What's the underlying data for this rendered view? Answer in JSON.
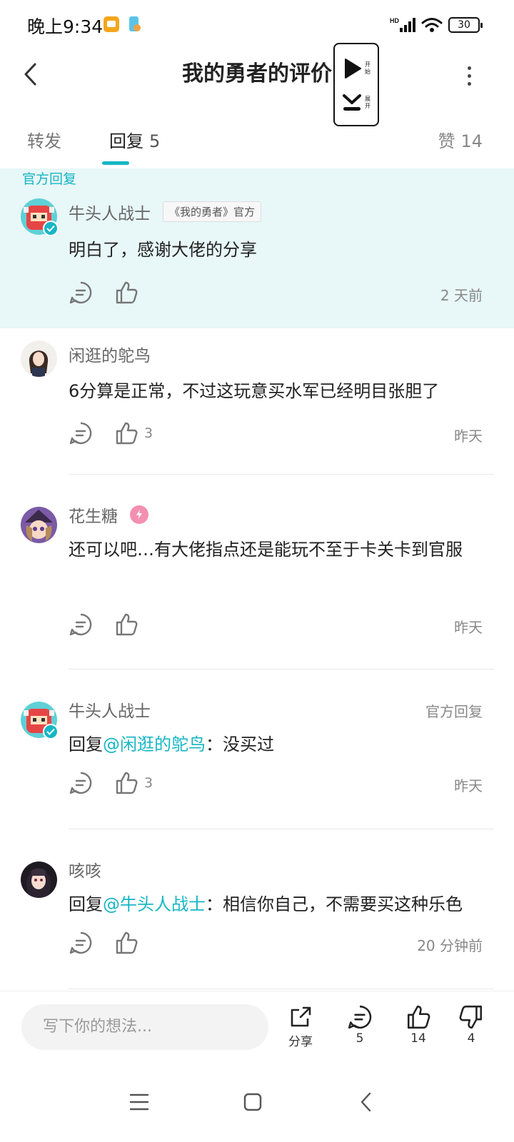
{
  "status": {
    "time": "晚上9:34",
    "network": "HD",
    "battery": "30"
  },
  "header": {
    "title": "我的勇者的评价"
  },
  "float_widget": {
    "start_label": "开始",
    "expand_label": "展开"
  },
  "tabs": {
    "repost": "转发",
    "reply": "回复",
    "reply_count": "5",
    "likes": "赞",
    "likes_count": "14"
  },
  "official_section": {
    "tag": "官方回复"
  },
  "comments": [
    {
      "name": "牛头人战士",
      "badge": "《我的勇者》官方",
      "content": "明白了，感谢大佬的分享",
      "likes": "",
      "time": "2 天前"
    },
    {
      "name": "闲逛的鸵鸟",
      "content": "6分算是正常，不过这玩意买水军已经明目张胆了",
      "likes": "3",
      "time": "昨天"
    },
    {
      "name": "花生糖",
      "content": "还可以吧…有大佬指点还是能玩不至于卡关卡到官服",
      "likes": "",
      "time": "昨天"
    },
    {
      "name": "牛头人战士",
      "right_tag": "官方回复",
      "reply_prefix": "回复",
      "mention": "@闲逛的鸵鸟",
      "content": "：没买过",
      "likes": "3",
      "time": "昨天"
    },
    {
      "name": "咳咳",
      "reply_prefix": "回复",
      "mention": "@牛头人战士",
      "content": "：相信你自己，不需要买这种乐色",
      "likes": "",
      "time": "20 分钟前"
    }
  ],
  "bottom_bar": {
    "input_placeholder": "写下你的想法...",
    "share_label": "分享",
    "comment_count": "5",
    "like_count": "14",
    "dislike_count": "4"
  },
  "colors": {
    "accent": "#16b6c5",
    "official_bg": "#e8f7f7"
  }
}
